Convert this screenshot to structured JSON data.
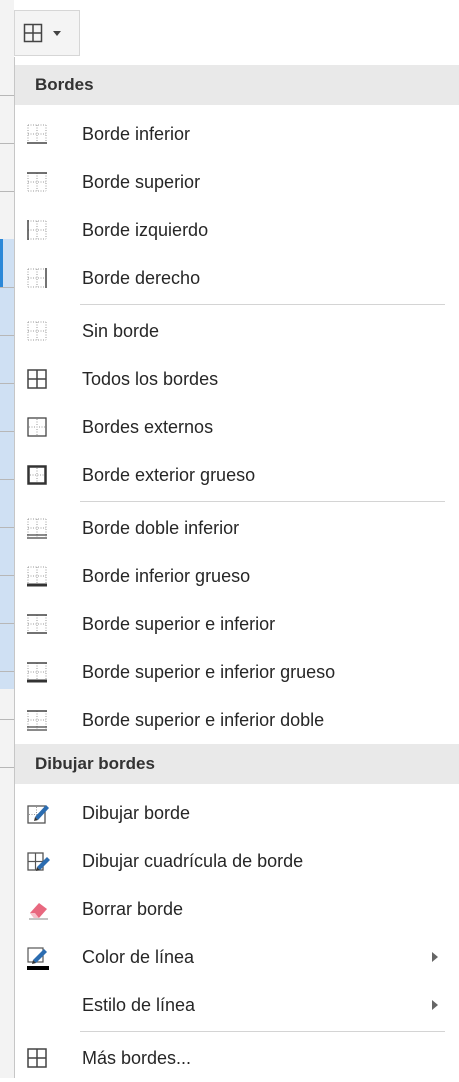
{
  "button": {
    "icon": "all-borders-icon",
    "dropdown": "chevron-down-icon"
  },
  "menu": {
    "sections": [
      {
        "header": "Bordes",
        "groups": [
          [
            {
              "label": "Borde inferior",
              "icon": "bottom-border-icon"
            },
            {
              "label": "Borde superior",
              "icon": "top-border-icon"
            },
            {
              "label": "Borde izquierdo",
              "icon": "left-border-icon"
            },
            {
              "label": "Borde derecho",
              "icon": "right-border-icon"
            }
          ],
          [
            {
              "label": "Sin borde",
              "icon": "no-border-icon"
            },
            {
              "label": "Todos los bordes",
              "icon": "all-borders-icon"
            },
            {
              "label": "Bordes externos",
              "icon": "outside-borders-icon"
            },
            {
              "label": "Borde exterior grueso",
              "icon": "thick-outside-border-icon"
            }
          ],
          [
            {
              "label": "Borde doble inferior",
              "icon": "double-bottom-border-icon"
            },
            {
              "label": "Borde inferior grueso",
              "icon": "thick-bottom-border-icon"
            },
            {
              "label": "Borde superior e inferior",
              "icon": "top-bottom-border-icon"
            },
            {
              "label": "Borde superior e inferior grueso",
              "icon": "top-thick-bottom-border-icon"
            },
            {
              "label": "Borde superior e inferior doble",
              "icon": "top-double-bottom-border-icon"
            }
          ]
        ]
      },
      {
        "header": "Dibujar bordes",
        "groups": [
          [
            {
              "label": "Dibujar borde",
              "icon": "draw-border-icon"
            },
            {
              "label": "Dibujar cuadrícula de borde",
              "icon": "draw-border-grid-icon"
            },
            {
              "label": "Borrar borde",
              "icon": "eraser-icon"
            },
            {
              "label": "Color de línea",
              "icon": "line-color-icon",
              "submenu": true
            },
            {
              "label": "Estilo de línea",
              "icon": "",
              "submenu": true
            }
          ],
          [
            {
              "label": "Más bordes...",
              "icon": "all-borders-icon"
            }
          ]
        ]
      }
    ]
  },
  "colors": {
    "line_color": "#000000",
    "eraser": "#e8687f",
    "pencil": "#2b6cb0"
  }
}
